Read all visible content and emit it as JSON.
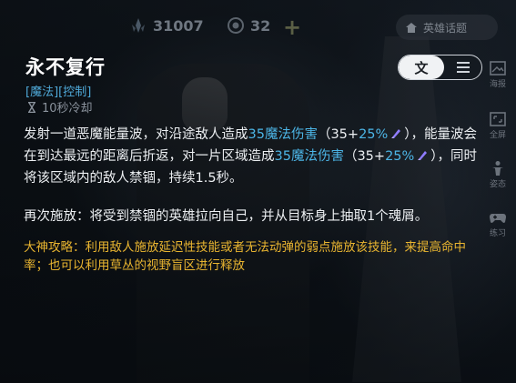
{
  "topbar": {
    "stat1_value": "31007",
    "stat1_icon": "crystal-icon",
    "stat2_value": "32",
    "stat2_icon": "coin-icon",
    "add_icon": "plus-icon",
    "hero_topic_label": "英雄话题",
    "hero_topic_icon": "home-icon"
  },
  "skill": {
    "name": "永不复行",
    "tags": "[魔法][控制]",
    "cooldown": "10秒冷却"
  },
  "toggle": {
    "text_label": "文",
    "list_icon": "list-icon"
  },
  "rail": [
    {
      "label": "海报",
      "icon": "poster-icon"
    },
    {
      "label": "全屏",
      "icon": "fullscreen-icon"
    },
    {
      "label": "姿态",
      "icon": "pose-icon"
    },
    {
      "label": "练习",
      "icon": "gamepad-icon"
    }
  ],
  "description": {
    "p1_a": "发射一道恶魔能量波，对沿途敌人造成",
    "p1_dmg1": "35魔法伤害",
    "p1_b": "（35+",
    "p1_pct1": "25%",
    "p1_c": "），能量波会在到达最远的距离后折返，对一片区域造成",
    "p1_dmg2": "35魔法伤害",
    "p1_d": "（35+",
    "p1_pct2": "25%",
    "p1_e": "），同时将该区域内的敌人禁锢，持续1.5秒。",
    "p2": "再次施放：将受到禁锢的英雄拉向自己，并从目标身上抽取1个魂屑。",
    "p3": "大神攻略：利用敌人施放延迟性技能或者无法动弹的弱点施放该技能，来提高命中率；也可以利用草丛的视野盲区进行释放"
  },
  "colors": {
    "magic_blue": "#4cb5e6",
    "tip_gold": "#e9b530",
    "gem_purple": "#8f7cff"
  }
}
